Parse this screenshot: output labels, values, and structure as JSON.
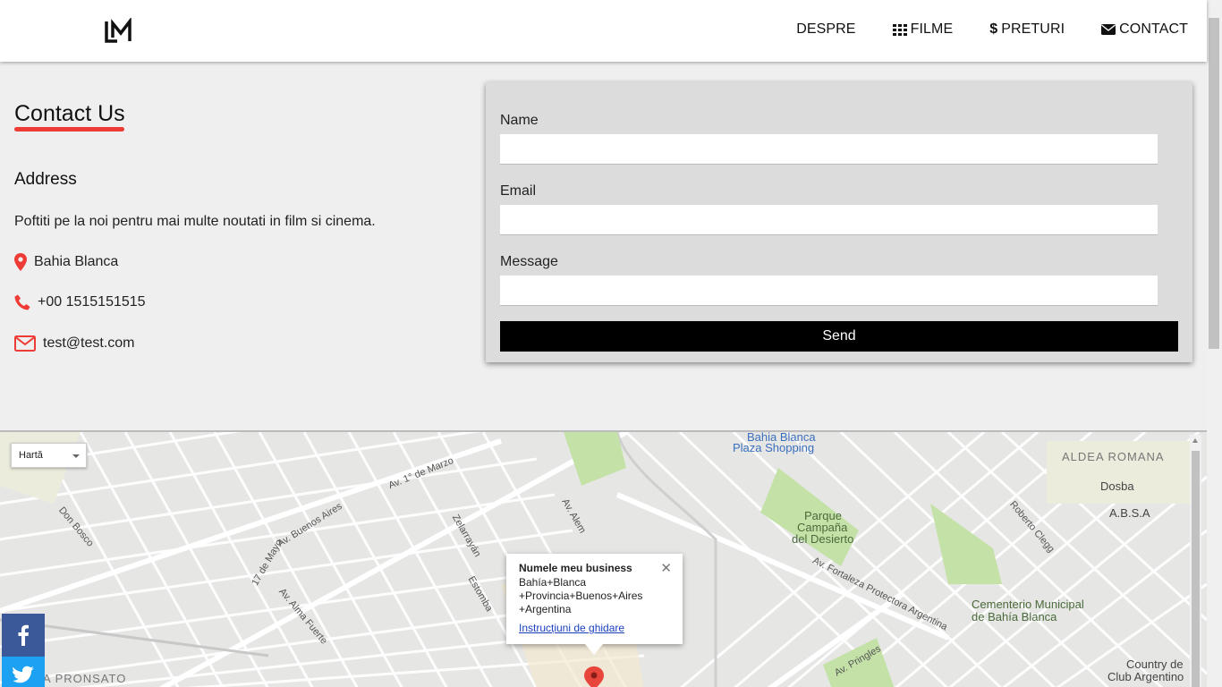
{
  "nav": {
    "items": [
      {
        "label": "DESPRE",
        "icon": ""
      },
      {
        "label": "FILME",
        "icon": "grid-icon"
      },
      {
        "label": "PRETURI",
        "icon": "dollar-icon"
      },
      {
        "label": "CONTACT",
        "icon": "envelope-icon"
      }
    ]
  },
  "contact": {
    "title": "Contact Us",
    "address_heading": "Address",
    "intro": "Poftiti pe la noi pentru mai multe noutati in film si cinema.",
    "location": "Bahia Blanca",
    "phone": "+00 1515151515",
    "email": "test@test.com"
  },
  "form": {
    "name_label": "Name",
    "name_value": "",
    "email_label": "Email",
    "email_value": "",
    "message_label": "Message",
    "message_value": "",
    "send_label": "Send"
  },
  "map": {
    "type_selector": "Hartă",
    "info": {
      "title": "Numele meu business",
      "line1": "Bahía+Blanca",
      "line2": "+Provincia+Buenos+Aires",
      "line3": "+Argentina",
      "link": "Instrucțiuni de ghidare"
    },
    "labels": {
      "plaza_shopping_1": "Bahia Blanca",
      "plaza_shopping_2": "Plaza Shopping",
      "aldea_romana": "ALDEA ROMANA",
      "dosba": "Dosba",
      "absa": "A.B.S.A",
      "parque_1": "Parque",
      "parque_2": "Campaña",
      "parque_3": "del Desierto",
      "cementerio_1": "Cementerio Municipal",
      "cementerio_2": "de Bahía Blanca",
      "country_1": "Country de",
      "country_2": "Club Argentino",
      "pronsato": "A PRONSATO",
      "street_1": "Av. 1° de Marzo",
      "street_2": "Av. Buenos Aires",
      "street_3": "Av. Alem",
      "street_4": "Av. Fortaleza Protectora Argentina",
      "street_5": "Zelarrayán",
      "street_6": "Estomba",
      "street_7": "Av. Alma Fuerte",
      "street_8": "Don Bosco",
      "street_9": "Av. Pringles",
      "street_10": "17 de Mayo",
      "street_11": "Roberto Clegg"
    }
  },
  "colors": {
    "accent": "#ef3b35",
    "facebook": "#3b5998",
    "twitter": "#1da1f2"
  }
}
